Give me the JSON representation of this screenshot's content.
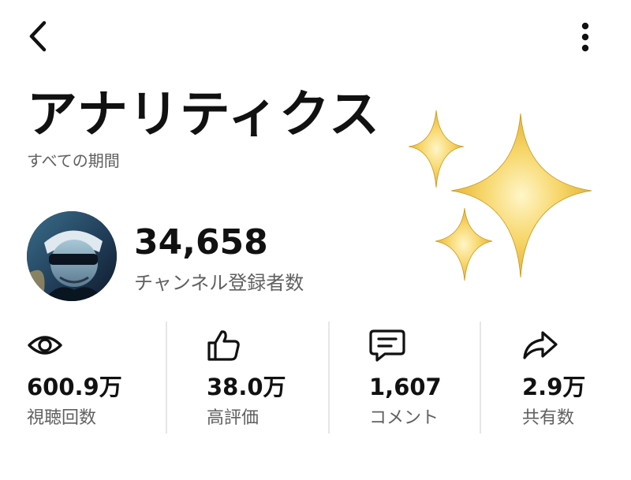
{
  "header": {
    "back_icon": "chevron-left-icon",
    "more_icon": "more-vertical-icon"
  },
  "title": "アナリティクス",
  "period": "すべての期間",
  "channel": {
    "subscriber_count": "34,658",
    "subscriber_label": "チャンネル登録者数"
  },
  "stats": [
    {
      "icon": "eye-icon",
      "value": "600.9万",
      "label": "視聴回数"
    },
    {
      "icon": "thumbs-up-icon",
      "value": "38.0万",
      "label": "高評価"
    },
    {
      "icon": "comment-icon",
      "value": "1,607",
      "label": "コメント"
    },
    {
      "icon": "share-icon",
      "value": "2.9万",
      "label": "共有数"
    }
  ],
  "colors": {
    "text_primary": "#111111",
    "text_secondary": "#606060",
    "divider": "#e6e6e6",
    "sparkle_gold": "#f2c94c"
  }
}
